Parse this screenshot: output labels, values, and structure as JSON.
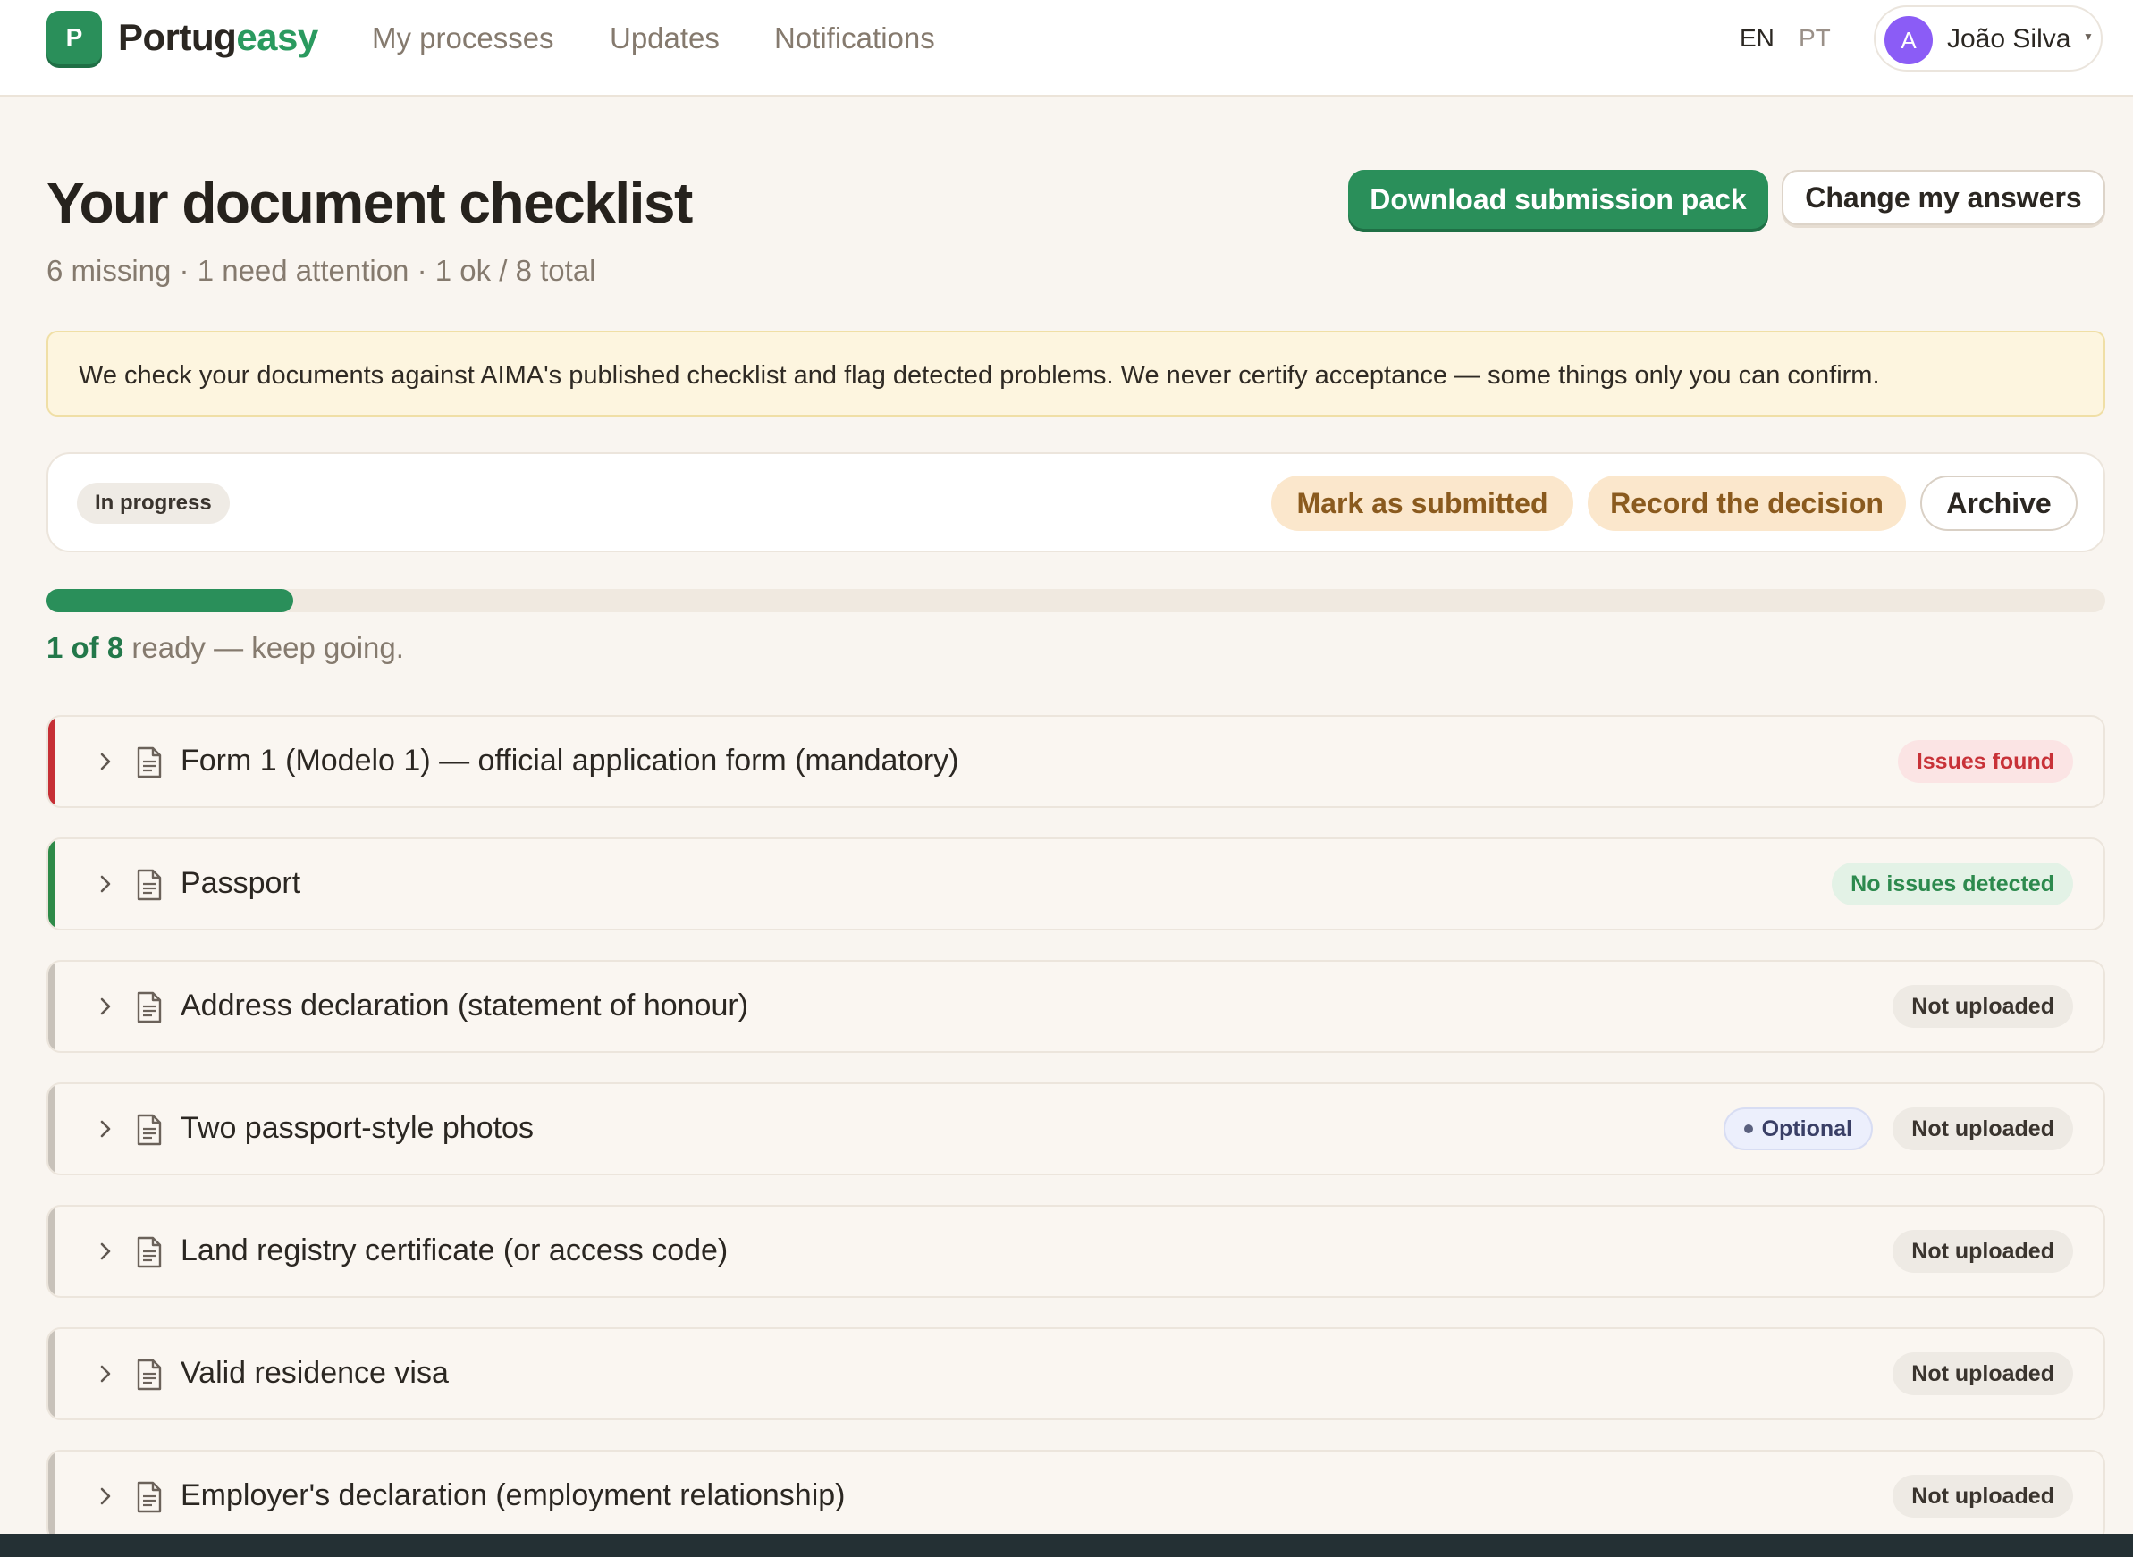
{
  "header": {
    "logo_letter": "P",
    "brand_part1": "Portug",
    "brand_part2": "easy",
    "nav": [
      "My processes",
      "Updates",
      "Notifications"
    ],
    "languages": [
      "EN",
      "PT"
    ],
    "active_language": "EN",
    "user": {
      "initial": "A",
      "name": "João Silva"
    }
  },
  "page": {
    "title": "Your document checklist",
    "summary": "6 missing · 1 need attention · 1 ok / 8 total",
    "download_label": "Download submission pack",
    "change_label": "Change my answers",
    "notice": "We check your documents against AIMA's published checklist and flag detected problems. We never certify acceptance — some things only you can confirm."
  },
  "status": {
    "state": "In progress",
    "mark_submitted": "Mark as submitted",
    "record_decision": "Record the decision",
    "archive": "Archive"
  },
  "progress": {
    "ready": 1,
    "total": 8,
    "count_text": "1 of 8",
    "rest_text": " ready — keep going."
  },
  "colors": {
    "accent_green": "#2a8f5a",
    "danger": "#c83238",
    "ok": "#2d8a4e",
    "neutral": "#c8c2ba"
  },
  "documents": [
    {
      "title": "Form 1 (Modelo 1) — official application form (mandatory)",
      "status": "Issues found",
      "tone": "danger",
      "optional": ""
    },
    {
      "title": "Passport",
      "status": "No issues detected",
      "tone": "ok",
      "optional": ""
    },
    {
      "title": "Address declaration (statement of honour)",
      "status": "Not uploaded",
      "tone": "none",
      "optional": ""
    },
    {
      "title": "Two passport-style photos",
      "status": "Not uploaded",
      "tone": "none",
      "optional": "Optional"
    },
    {
      "title": "Land registry certificate (or access code)",
      "status": "Not uploaded",
      "tone": "none",
      "optional": ""
    },
    {
      "title": "Valid residence visa",
      "status": "Not uploaded",
      "tone": "none",
      "optional": ""
    },
    {
      "title": "Employer's declaration (employment relationship)",
      "status": "Not uploaded",
      "tone": "none",
      "optional": ""
    }
  ]
}
